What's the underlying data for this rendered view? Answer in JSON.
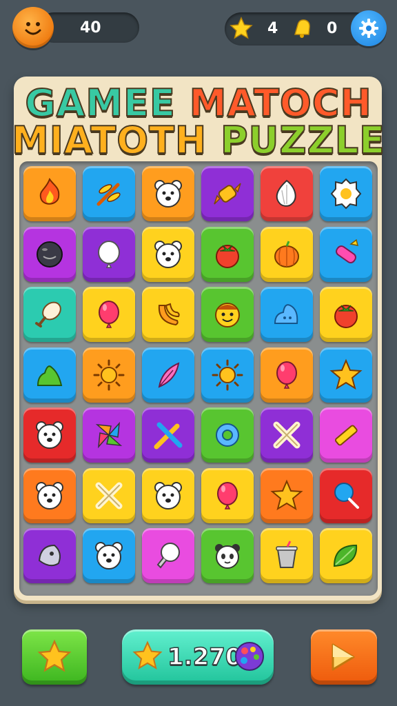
{
  "hud": {
    "player_score": "40",
    "stars": "4",
    "bells": "0",
    "colors": {
      "background": "#4a555d",
      "pill": "#333c42"
    }
  },
  "title": {
    "line1_part1": "GAMEE",
    "line1_part2": "MATOCH",
    "line2_part1": "MIATOTH",
    "line2_part2": "PUZZLE"
  },
  "board": {
    "rows": [
      [
        {
          "color": "#ff9d1e",
          "icon": "fire-icon"
        },
        {
          "color": "#22a6f0",
          "icon": "dragonfly-icon"
        },
        {
          "color": "#ff9d1e",
          "icon": "bear-face-icon"
        },
        {
          "color": "#8f2fd6",
          "icon": "candy-icon"
        },
        {
          "color": "#f0413c",
          "icon": "garlic-icon"
        },
        {
          "color": "#22a6f0",
          "icon": "egg-icon"
        }
      ],
      [
        {
          "color": "#b534e0",
          "icon": "black-ball-icon"
        },
        {
          "color": "#8f2fd6",
          "icon": "white-balloon-icon"
        },
        {
          "color": "#ffd21e",
          "icon": "bear-face-icon"
        },
        {
          "color": "#58c530",
          "icon": "tomato-icon"
        },
        {
          "color": "#ffd21e",
          "icon": "pumpkin-icon"
        },
        {
          "color": "#22a6f0",
          "icon": "crayon-icon"
        }
      ],
      [
        {
          "color": "#2ccbb0",
          "icon": "drumstick-icon"
        },
        {
          "color": "#ffd21e",
          "icon": "balloon-icon"
        },
        {
          "color": "#ffd21e",
          "icon": "banana-icon"
        },
        {
          "color": "#58c530",
          "icon": "smiley-icon"
        },
        {
          "color": "#22a6f0",
          "icon": "blob-icon"
        },
        {
          "color": "#ffd21e",
          "icon": "tomato-icon"
        }
      ],
      [
        {
          "color": "#22a6f0",
          "icon": "slime-icon"
        },
        {
          "color": "#ff9d1e",
          "icon": "sun-icon"
        },
        {
          "color": "#22a6f0",
          "icon": "feather-icon"
        },
        {
          "color": "#22a6f0",
          "icon": "sun-icon"
        },
        {
          "color": "#ff9d1e",
          "icon": "balloon-icon"
        },
        {
          "color": "#22a6f0",
          "icon": "star-icon"
        }
      ],
      [
        {
          "color": "#e62a2a",
          "icon": "bear-face-icon"
        },
        {
          "color": "#b534e0",
          "icon": "pinwheel-icon"
        },
        {
          "color": "#8f2fd6",
          "icon": "crossed-pencils-icon"
        },
        {
          "color": "#58c530",
          "icon": "ring-icon"
        },
        {
          "color": "#8f2fd6",
          "icon": "cross-icon"
        },
        {
          "color": "#e94ce0",
          "icon": "pencil-icon"
        }
      ],
      [
        {
          "color": "#ff7a1e",
          "icon": "bear-face-icon"
        },
        {
          "color": "#ffd21e",
          "icon": "cross-icon"
        },
        {
          "color": "#ffd21e",
          "icon": "bear-face-icon"
        },
        {
          "color": "#ffd21e",
          "icon": "balloon-icon"
        },
        {
          "color": "#ff7a1e",
          "icon": "star-icon"
        },
        {
          "color": "#e62a2a",
          "icon": "lollipop-icon"
        }
      ],
      [
        {
          "color": "#8f2fd6",
          "icon": "shell-icon"
        },
        {
          "color": "#22a6f0",
          "icon": "bear-face-icon"
        },
        {
          "color": "#e94ce0",
          "icon": "bulb-icon"
        },
        {
          "color": "#58c530",
          "icon": "panda-icon"
        },
        {
          "color": "#ffd21e",
          "icon": "cup-icon"
        },
        {
          "color": "#ffd21e",
          "icon": "leaf-icon"
        }
      ]
    ]
  },
  "footer": {
    "score": "1.270",
    "star_button_icon": "star-icon",
    "score_icons": [
      "star-icon",
      "palette-icon"
    ],
    "next_button_icon": "arrow-right-icon"
  }
}
